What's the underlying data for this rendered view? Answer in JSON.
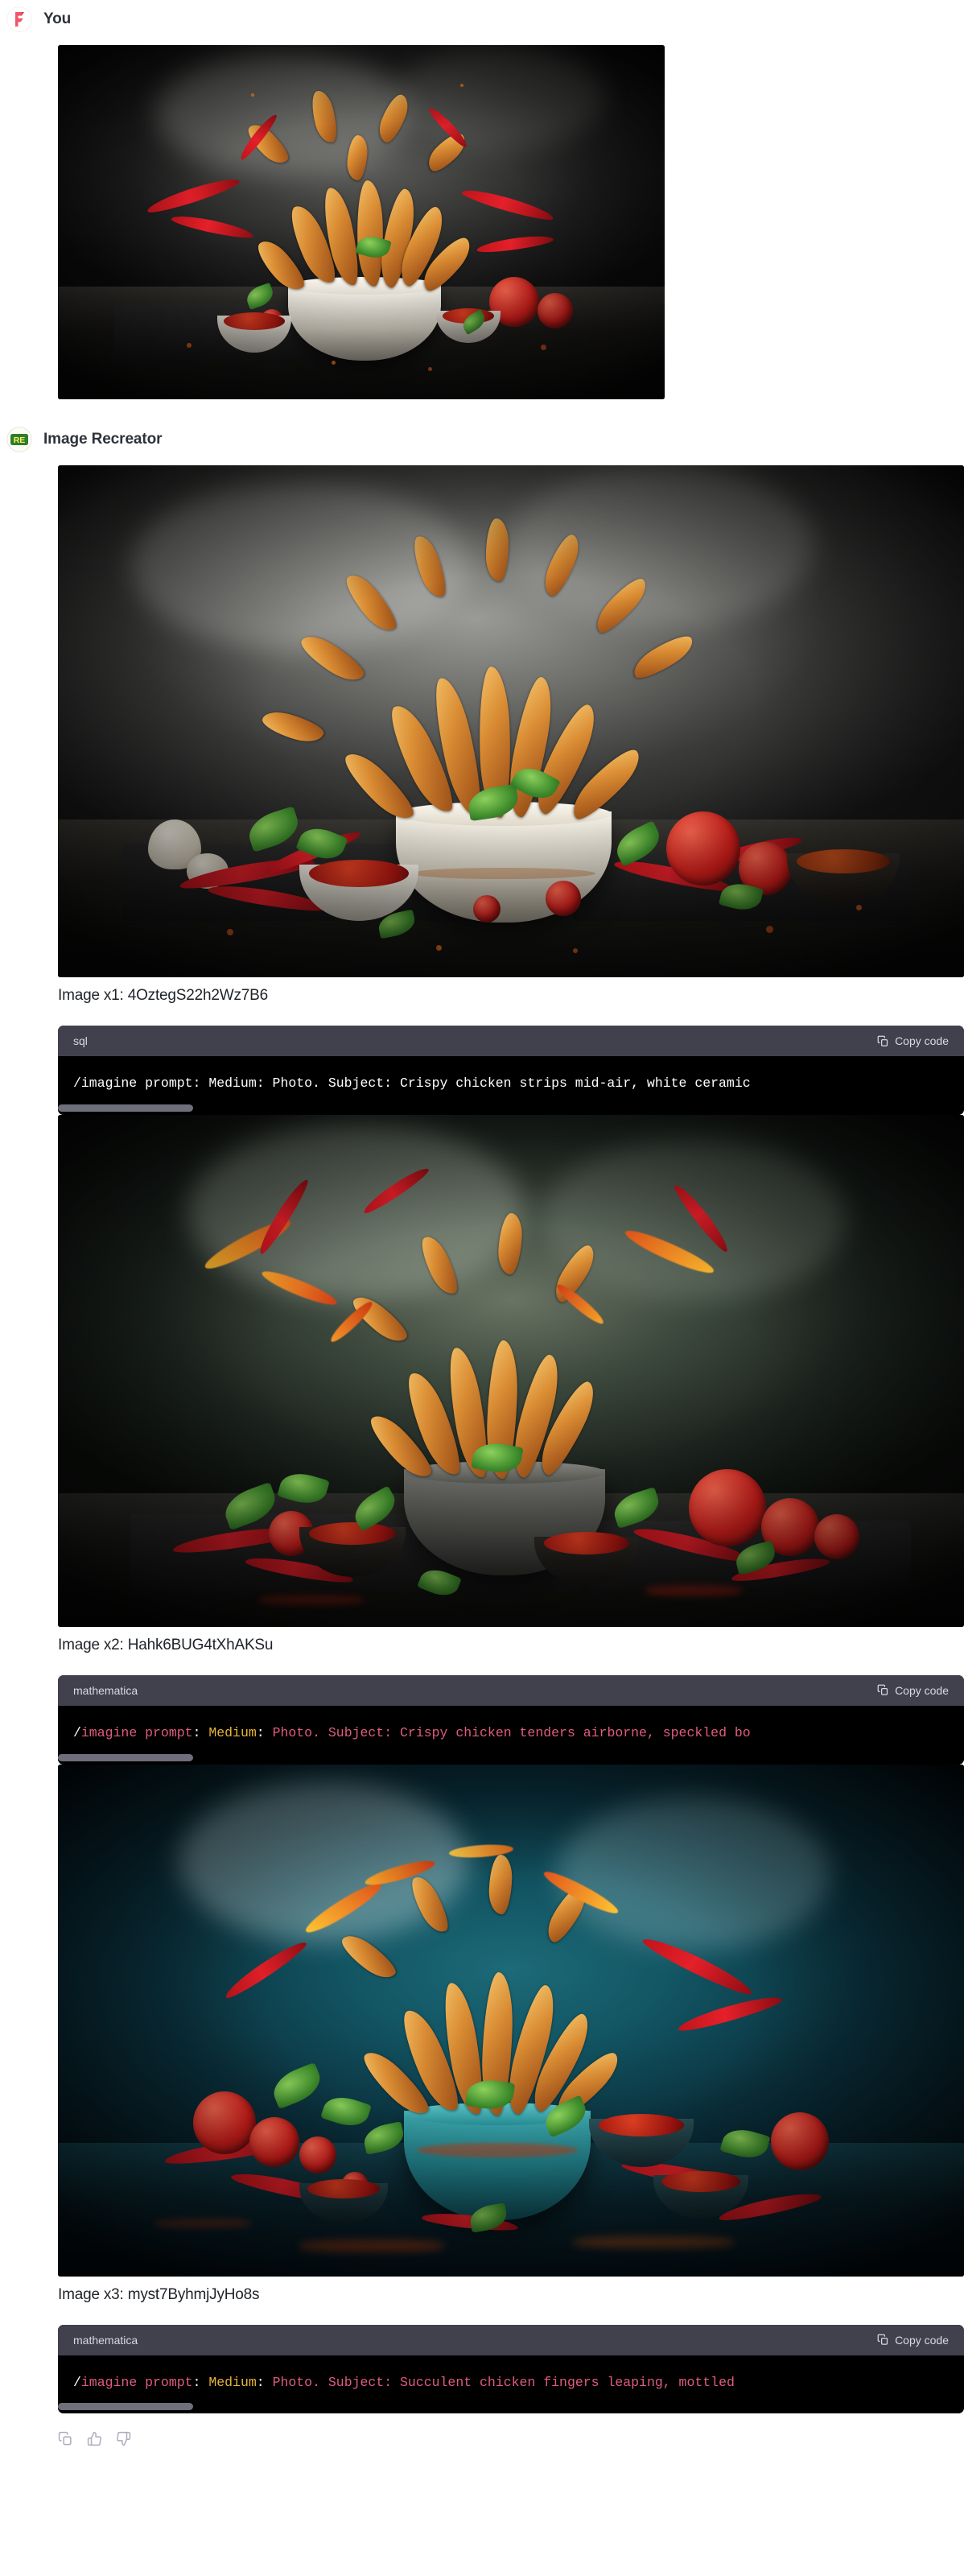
{
  "conversation": {
    "messages": [
      {
        "author": "You",
        "avatar_icon": "flowgpt-logo-icon",
        "attachment_alt": "Crispy chicken strips bursting from white bowl with chilies and sauce"
      },
      {
        "author": "Image Recreator",
        "avatar_icon": "re-logo-icon"
      }
    ]
  },
  "results": [
    {
      "caption": "Image x1: 4OztegS22h2Wz7B6",
      "image_alt": "Crispy chicken strips mid-air over white ceramic bowl with basil, tomatoes, chilies and sauce",
      "code": {
        "language": "sql",
        "copy_label": "Copy code",
        "copy_icon": "clipboard-icon",
        "highlighted": false,
        "text": "/imagine prompt: Medium: Photo. Subject: Crispy chicken strips mid-air, white ceramic",
        "tokens": [
          {
            "t": "/imagine prompt: Medium: Photo. Subject: Crispy chicken strips mid-air, white ceramic",
            "c": "white"
          }
        ]
      }
    },
    {
      "caption": "Image x2: Hahk6BUG4tXhAKSu",
      "image_alt": "Chicken tenders airborne above speckled stone bowl with tomatoes, basil and red sauce",
      "code": {
        "language": "mathematica",
        "copy_label": "Copy code",
        "copy_icon": "clipboard-icon",
        "highlighted": true,
        "text": "/imagine prompt: Medium: Photo. Subject: Crispy chicken tenders airborne, speckled bo",
        "tokens": [
          {
            "t": "/",
            "c": "white"
          },
          {
            "t": "imagine prompt",
            "c": "pink"
          },
          {
            "t": ": ",
            "c": "white"
          },
          {
            "t": "Medium",
            "c": "gold"
          },
          {
            "t": ": ",
            "c": "white"
          },
          {
            "t": "Photo. Subject: Crispy chicken tenders airborne, speckled bo",
            "c": "pink"
          }
        ]
      }
    },
    {
      "caption": "Image x3: myst7ByhmjJyHo8s",
      "image_alt": "Succulent chicken fingers leaping from mottled teal bowl with chilies, tomatoes and basil",
      "code": {
        "language": "mathematica",
        "copy_label": "Copy code",
        "copy_icon": "clipboard-icon",
        "highlighted": true,
        "text": "/imagine prompt: Medium: Photo. Subject: Succulent chicken fingers leaping, mottled",
        "tokens": [
          {
            "t": "/",
            "c": "white"
          },
          {
            "t": "imagine prompt",
            "c": "pink"
          },
          {
            "t": ": ",
            "c": "white"
          },
          {
            "t": "Medium",
            "c": "gold"
          },
          {
            "t": ": ",
            "c": "white"
          },
          {
            "t": "Photo. Subject: Succulent chicken fingers leaping, mottled",
            "c": "pink"
          }
        ]
      }
    }
  ],
  "actions": [
    {
      "name": "copy-message",
      "icon": "clipboard-icon"
    },
    {
      "name": "thumbs-up",
      "icon": "thumbs-up-icon"
    },
    {
      "name": "thumbs-down",
      "icon": "thumbs-down-icon"
    }
  ],
  "colors": {
    "code_header_bg": "#41414e",
    "code_body_bg": "#000000",
    "token_pink": "#e05c7e",
    "token_gold": "#e8b339",
    "text_primary": "#1f2328",
    "icon_muted": "#acacbe",
    "user_avatar": "#f2546a",
    "bot_avatar": "#2f7d32"
  }
}
